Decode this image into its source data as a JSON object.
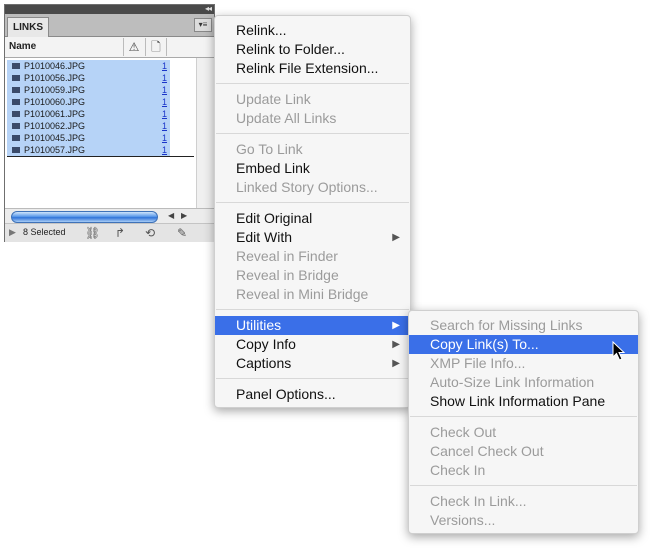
{
  "panel": {
    "tab_label": "LINKS",
    "header": {
      "name_col": "Name"
    },
    "files": [
      {
        "name": "P1010046.JPG",
        "page": "1"
      },
      {
        "name": "P1010056.JPG",
        "page": "1"
      },
      {
        "name": "P1010059.JPG",
        "page": "1"
      },
      {
        "name": "P1010060.JPG",
        "page": "1"
      },
      {
        "name": "P1010061.JPG",
        "page": "1"
      },
      {
        "name": "P1010062.JPG",
        "page": "1"
      },
      {
        "name": "P1010045.JPG",
        "page": "1"
      },
      {
        "name": "P1010057.JPG",
        "page": "1"
      }
    ],
    "footer": {
      "selected_text": "8 Selected"
    },
    "icons": [
      "warning-icon",
      "page-icon",
      "relink-icon",
      "go-to-link-icon",
      "update-link-icon",
      "edit-original-icon"
    ]
  },
  "context_menu": {
    "relink": "Relink...",
    "relink_folder": "Relink to Folder...",
    "relink_ext": "Relink File Extension...",
    "update_link": "Update Link",
    "update_all": "Update All Links",
    "go_to_link": "Go To Link",
    "embed_link": "Embed Link",
    "linked_story": "Linked Story Options...",
    "edit_original": "Edit Original",
    "edit_with": "Edit With",
    "reveal_finder": "Reveal in Finder",
    "reveal_bridge": "Reveal in Bridge",
    "reveal_mini_bridge": "Reveal in Mini Bridge",
    "utilities": "Utilities",
    "copy_info": "Copy Info",
    "captions": "Captions",
    "panel_options": "Panel Options..."
  },
  "utilities_menu": {
    "search_missing": "Search for Missing Links",
    "copy_links": "Copy Link(s) To...",
    "xmp_info": "XMP File Info...",
    "autosize": "Auto-Size Link Information",
    "show_pane": "Show Link Information Pane",
    "check_out": "Check Out",
    "cancel_check_out": "Cancel Check Out",
    "check_in": "Check In",
    "check_in_link": "Check In Link...",
    "versions": "Versions..."
  },
  "colors": {
    "highlight": "#3a6fe8",
    "selection": "#b6d3f7",
    "disabled": "#9b9b9b"
  }
}
